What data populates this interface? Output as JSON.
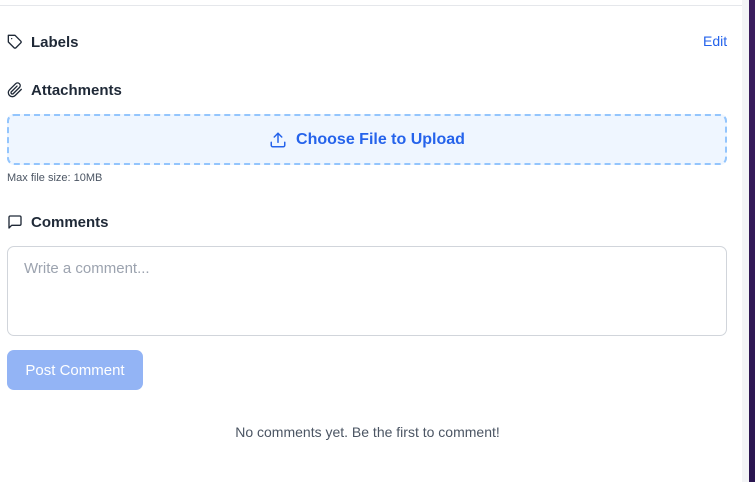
{
  "labels": {
    "title": "Labels",
    "edit_label": "Edit",
    "icon": "tag-icon"
  },
  "attachments": {
    "title": "Attachments",
    "icon": "paperclip-icon",
    "upload_label": "Choose File to Upload",
    "upload_icon": "upload-icon",
    "max_size_text": "Max file size: 10MB"
  },
  "comments": {
    "title": "Comments",
    "icon": "message-square-icon",
    "input_placeholder": "Write a comment...",
    "input_value": "",
    "post_label": "Post Comment",
    "empty_text": "No comments yet. Be the first to comment!"
  },
  "colors": {
    "accent": "#2563eb",
    "upload_bg": "#eff6ff",
    "upload_border": "#93c5fd",
    "post_button_disabled": "#93b4f5"
  }
}
